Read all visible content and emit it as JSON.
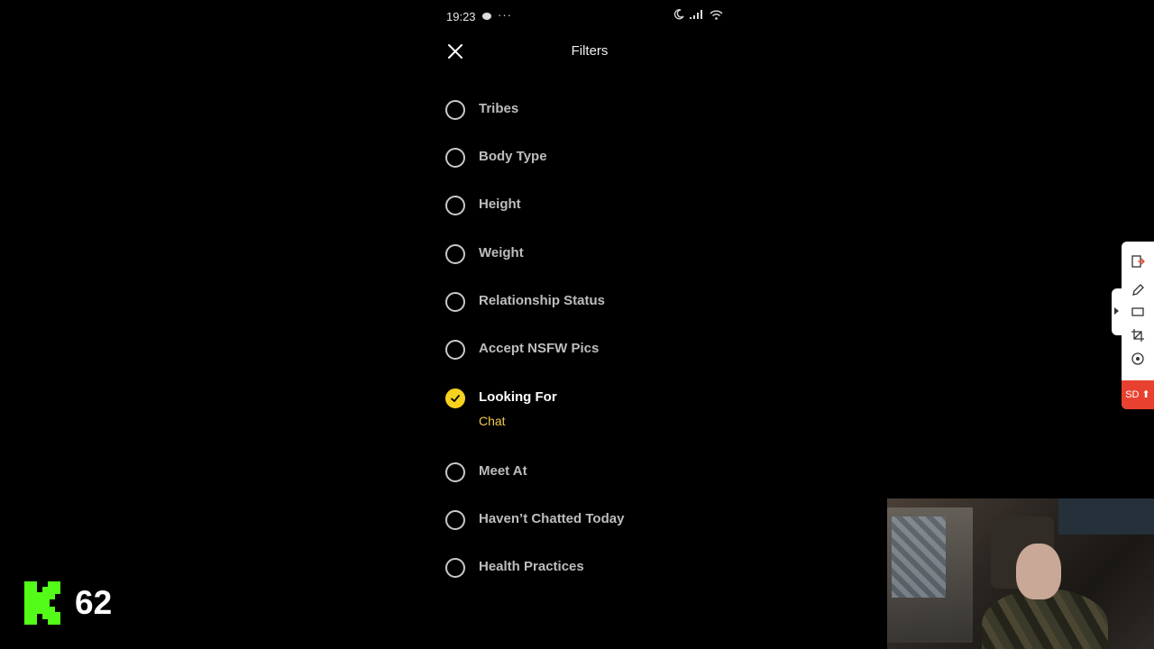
{
  "status_bar": {
    "time": "19:23",
    "dots": "···",
    "icons": [
      "chat-bubble-icon",
      "moon-icon",
      "signal-icon",
      "wifi-icon"
    ]
  },
  "header": {
    "title": "Filters",
    "close_icon": "close-icon"
  },
  "filters": [
    {
      "label": "Tribes",
      "checked": false
    },
    {
      "label": "Body Type",
      "checked": false
    },
    {
      "label": "Height",
      "checked": false
    },
    {
      "label": "Weight",
      "checked": false
    },
    {
      "label": "Relationship Status",
      "checked": false
    },
    {
      "label": "Accept NSFW Pics",
      "checked": false
    },
    {
      "label": "Looking For",
      "checked": true,
      "value": "Chat"
    },
    {
      "label": "Meet At",
      "checked": false
    },
    {
      "label": "Haven’t Chatted Today",
      "checked": false
    },
    {
      "label": "Health Practices",
      "checked": false
    }
  ],
  "overlay": {
    "viewer_count": "62",
    "logo": "kick-logo-icon"
  },
  "side_toolbar": {
    "tools": [
      "exit-icon",
      "pen-icon",
      "rectangle-icon",
      "crop-icon",
      "record-icon"
    ],
    "sd_label": "SD"
  },
  "colors": {
    "accent_yellow": "#f7d21e",
    "selected_value": "#f2c84b",
    "kick_green": "#53fc18",
    "sd_red": "#e8412f"
  }
}
